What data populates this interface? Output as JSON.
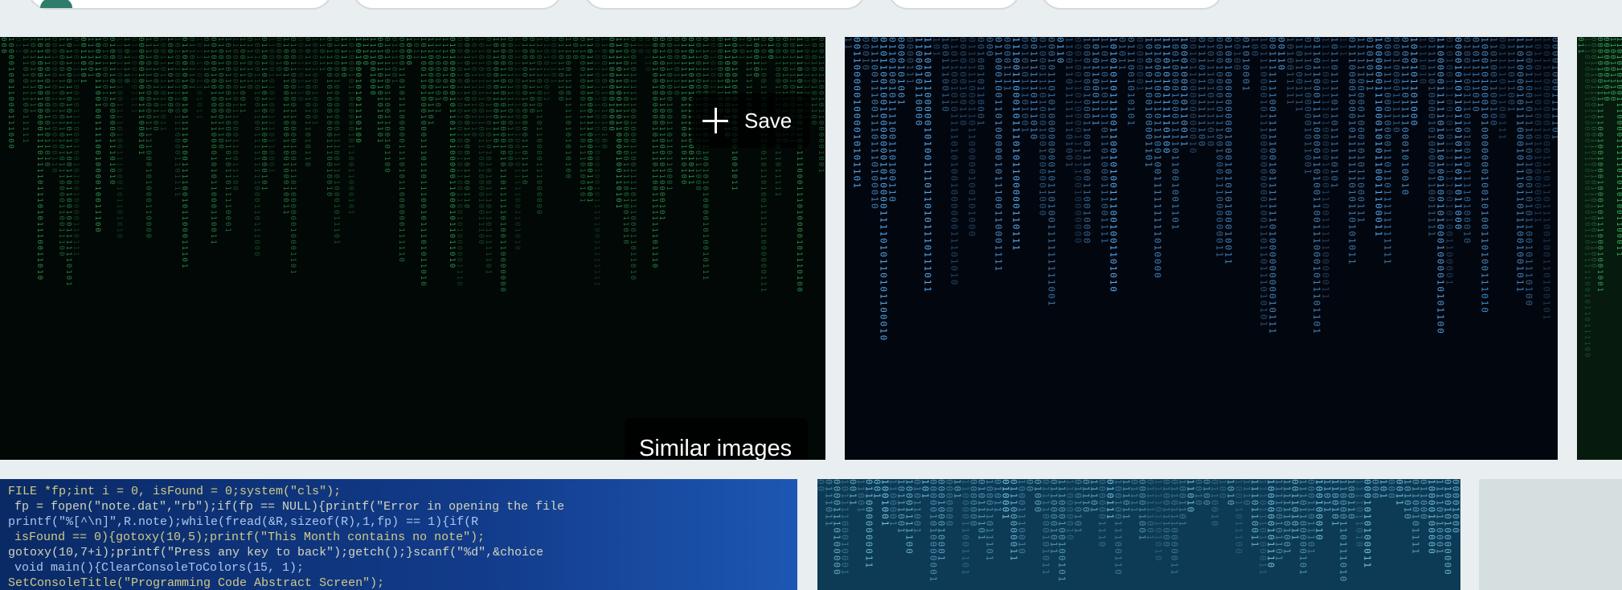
{
  "filter_chips": [
    "",
    "",
    "",
    "",
    ""
  ],
  "results": [
    {
      "id": "matrix-green",
      "theme": "green binary code rain",
      "colors": {
        "bg": "#020805",
        "glyph": "#2fa35a"
      }
    },
    {
      "id": "matrix-blue",
      "theme": "blue binary code rain",
      "colors": {
        "bg": "#02060f",
        "glyph": "#5fb8ff"
      }
    },
    {
      "id": "matrix-green-partial",
      "theme": "green code rain (clipped)",
      "colors": {
        "bg": "#071a0e",
        "glyph": "#3fbf6a"
      }
    },
    {
      "id": "source-code",
      "theme": "blurred programming source code",
      "colors": {
        "bg": "#0b2c6b",
        "glyph": "#e6d98a"
      }
    },
    {
      "id": "matrix-teal",
      "theme": "teal binary code",
      "colors": {
        "bg": "#0d3a55",
        "glyph": "#7fd3ee"
      }
    },
    {
      "id": "placeholder",
      "theme": "empty tile",
      "colors": {
        "bg": "#d5dfe0"
      }
    }
  ],
  "overlay": {
    "save_label": "Save",
    "similar_label": "Similar images"
  },
  "code_lines": [
    "FILE *fp;int i = 0, isFound = 0;system(\"cls\");",
    "fp = fopen(\"note.dat\",\"rb\");if(fp == NULL){printf(\"Error in opening the file",
    "printf(\"%[^\\n]\",R.note);while(fread(&R,sizeof(R),1,fp) == 1){if(R",
    "isFound == 0){gotoxy(10,5);printf(\"This Month contains no note\");",
    "gotoxy(10,7+i);printf(\"Press any key to back\");getch();}scanf(\"%d\",&choice",
    "void main(){ClearConsoleToColors(15, 1);",
    "SetConsoleTitle(\"Programming Code Abstract Screen\");"
  ]
}
